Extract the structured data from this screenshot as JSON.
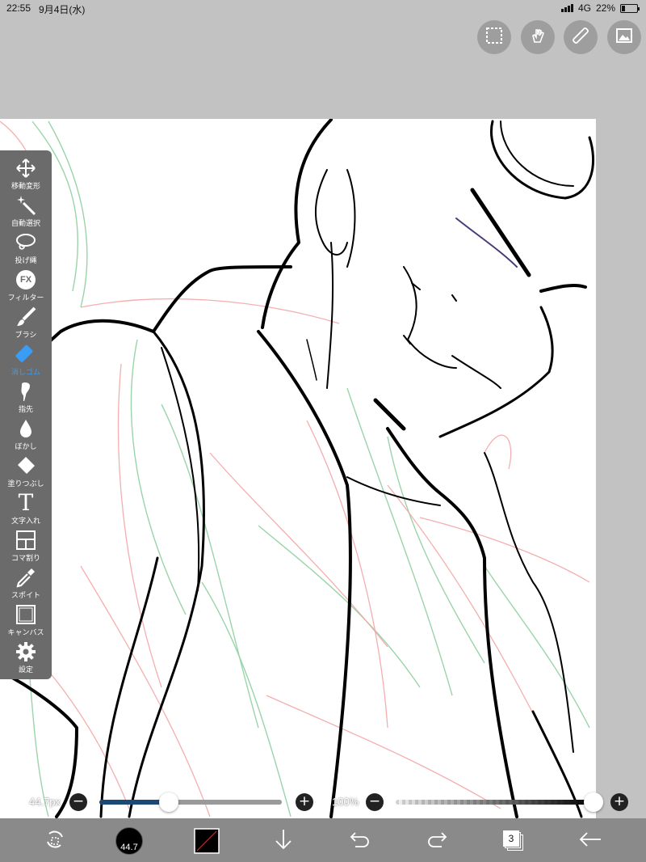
{
  "status": {
    "time": "22:55",
    "date": "9月4日(水)",
    "network": "4G",
    "battery": "22%",
    "battery_level": 0.22
  },
  "top_buttons": [
    {
      "icon": "selection-icon"
    },
    {
      "icon": "gesture-hand-icon"
    },
    {
      "icon": "ruler-icon"
    },
    {
      "icon": "material-image-icon"
    }
  ],
  "tools": [
    {
      "icon": "move-transform-icon",
      "label": "移動変形"
    },
    {
      "icon": "magic-wand-icon",
      "label": "自動選択"
    },
    {
      "icon": "lasso-icon",
      "label": "投げ縄"
    },
    {
      "icon": "fx-filter-icon",
      "label": "フィルター",
      "fx_text": "FX"
    },
    {
      "icon": "brush-icon",
      "label": "ブラシ"
    },
    {
      "icon": "eraser-icon",
      "label": "消しゴム",
      "active": true
    },
    {
      "icon": "finger-smudge-icon",
      "label": "指先"
    },
    {
      "icon": "blur-drop-icon",
      "label": "ぼかし"
    },
    {
      "icon": "bucket-fill-icon",
      "label": "塗りつぶし"
    },
    {
      "icon": "text-icon",
      "label": "文字入れ",
      "glyph": "T"
    },
    {
      "icon": "frame-divider-icon",
      "label": "コマ割り"
    },
    {
      "icon": "eyedropper-icon",
      "label": "スポイト"
    },
    {
      "icon": "canvas-icon",
      "label": "キャンバス"
    },
    {
      "icon": "gear-icon",
      "label": "設定"
    }
  ],
  "brush_size": {
    "value_label": "44.7px",
    "level": 0.38
  },
  "opacity": {
    "value_label": "100%",
    "level": 1.0
  },
  "bottom_bar": {
    "brush_preview_label": "44.7",
    "layer_count": "3"
  },
  "colors": {
    "active_tool": "#3b9cf3",
    "slider_fill": "#1d4a74",
    "sketch_green": "#8fd0a0",
    "sketch_red": "#f3a6a6"
  }
}
